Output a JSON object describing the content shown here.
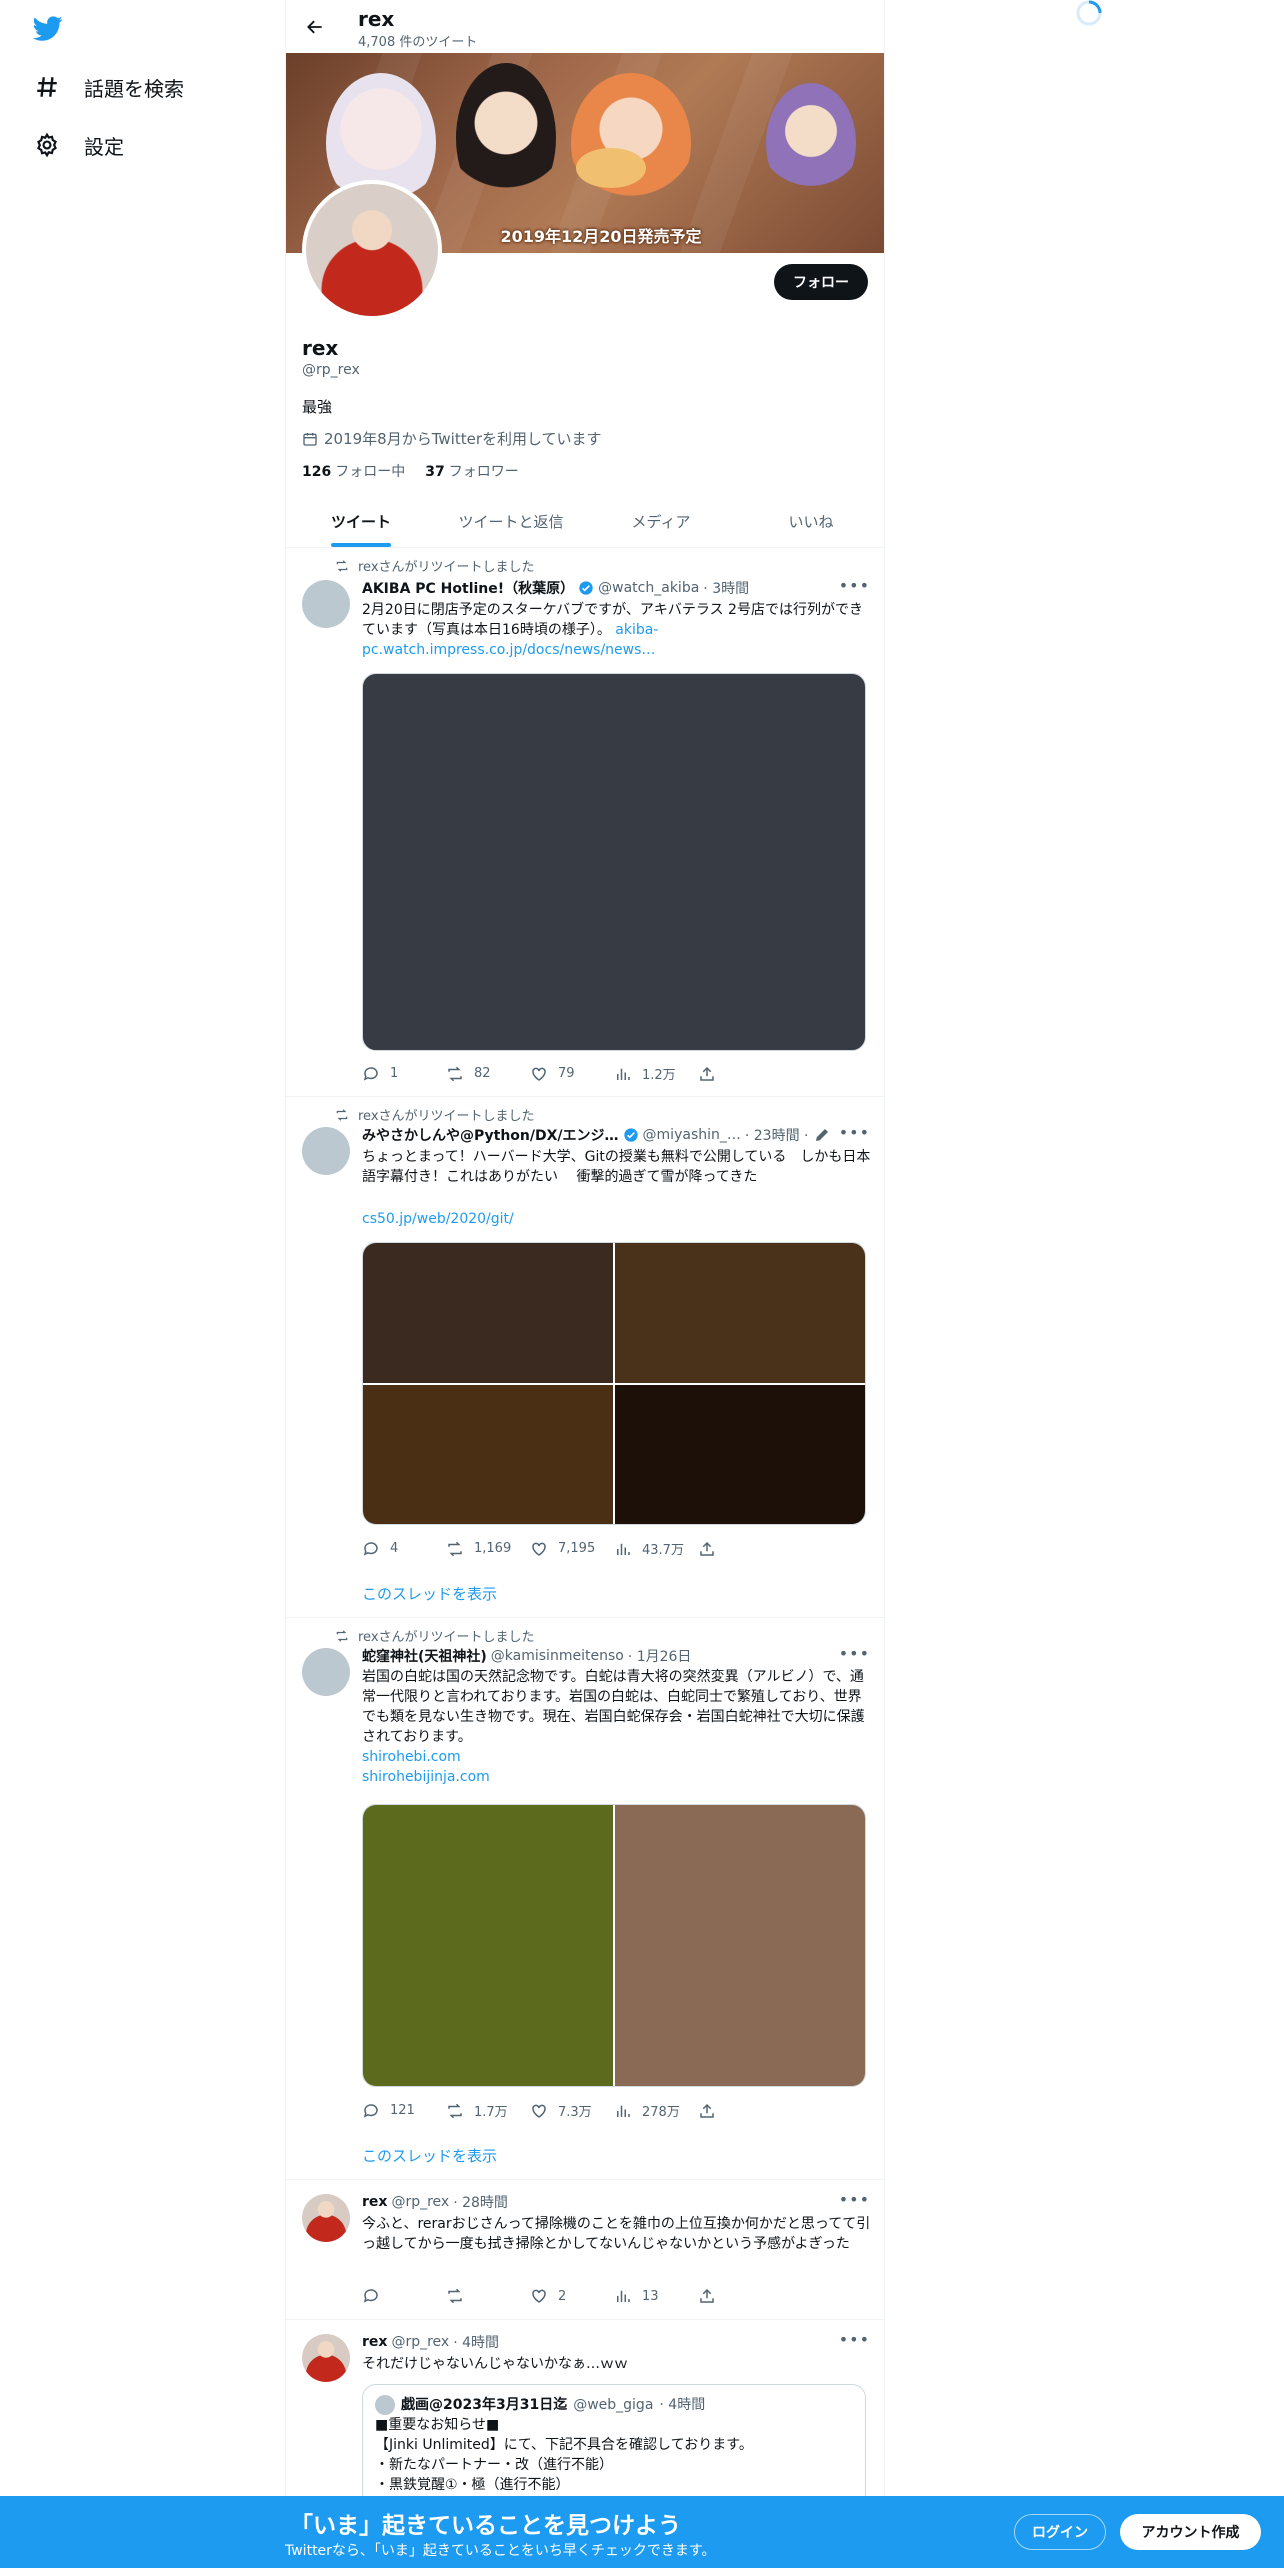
{
  "sidebar": {
    "logo": "twitter-bird-icon",
    "items": [
      {
        "icon": "hashtag-icon",
        "label": "話題を検索"
      },
      {
        "icon": "gear-icon",
        "label": "設定"
      }
    ]
  },
  "header": {
    "name": "rex",
    "tweet_count": "4,708 件のツイート"
  },
  "banner": {
    "caption": "2019年12月20日発売予定"
  },
  "profile": {
    "follow_button": "フォロー",
    "name": "rex",
    "handle": "@rp_rex",
    "bio": "最強",
    "joined": "2019年8月からTwitterを利用しています",
    "following_count": "126",
    "following_label": "フォロー中",
    "followers_count": "37",
    "followers_label": "フォロワー"
  },
  "tabs": [
    {
      "label": "ツイート",
      "active": true
    },
    {
      "label": "ツイートと返信",
      "active": false
    },
    {
      "label": "メディア",
      "active": false
    },
    {
      "label": "いいね",
      "active": false
    }
  ],
  "tweets": [
    {
      "retweeted_by": "rexさんがリツイートしました",
      "name": "AKIBA PC Hotline!（秋葉原）",
      "verified": true,
      "handle": "@watch_akiba",
      "time": "· 3時間",
      "text": "2月20日に閉店予定のスターケバブですが、アキバテラス 2号店では行列ができています（写真は本日16時頃の様子）。",
      "link": "akiba-pc.watch.impress.co.jp/docs/news/news…",
      "replies": "1",
      "retweets": "82",
      "likes": "79",
      "views": "1.2万",
      "media_color": "#363b44"
    },
    {
      "retweeted_by": "rexさんがリツイートしました",
      "name": "みやさかしんや@Python/DX/エンジ…",
      "verified": true,
      "handle": "@miyashin_…",
      "time": "· 23時間 ·",
      "text": "ちょっとまって！ハーバード大学、Gitの授業も無料で公開している　しかも日本語字幕付き！これはありがたい　 衝撃的過ぎて雪が降ってきた",
      "link": "cs50.jp/web/2020/git/",
      "replies": "4",
      "retweets": "1,169",
      "likes": "7,195",
      "views": "43.7万",
      "media_colors": [
        "#3a2a1f",
        "#4a3119",
        "#4b2f14",
        "#1c1009"
      ],
      "thread_link": "このスレッドを表示"
    },
    {
      "retweeted_by": "rexさんがリツイートしました",
      "name": "蛇窪神社(天祖神社)",
      "verified": false,
      "handle": "@kamisinmeitenso",
      "time": "· 1月26日",
      "text": "岩国の白蛇は国の天然記念物です。白蛇は青大将の突然変異（アルビノ）で、通常一代限りと言われております。岩国の白蛇は、白蛇同士で繁殖しており、世界でも類を見ない生き物です。現在、岩国白蛇保存会・岩国白蛇神社で大切に保護されております。",
      "links": [
        "shirohebi.com",
        "shirohebijinja.com"
      ],
      "replies": "121",
      "retweets": "1.7万",
      "likes": "7.3万",
      "views": "278万",
      "media_colors": [
        "#5b6a1c",
        "#8b6a55"
      ],
      "thread_link": "このスレッドを表示"
    },
    {
      "name": "rex",
      "handle": "@rp_rex",
      "time": "· 28時間",
      "text": "今ふと、rerarおじさんって掃除機のことを雑巾の上位互換か何かだと思ってて引っ越してから一度も拭き掃除とかしてないんじゃないかという予感がよぎった",
      "replies": "",
      "retweets": "",
      "likes": "2",
      "views": "13"
    },
    {
      "name": "rex",
      "handle": "@rp_rex",
      "time": "· 4時間",
      "text": "それだけじゃないんじゃないかなぁ…ｗｗ",
      "quote": {
        "name": "戯画@2023年3月31日迄",
        "handle": "@web_giga",
        "time": "· 4時間",
        "lines": [
          "■重要なお知らせ■",
          "【Jinki Unlimited】にて、下記不具合を確認しております。",
          "・新たなパートナー・改（進行不能）",
          "・黒鉄覚醒①・極（進行不能）"
        ]
      }
    }
  ],
  "bottom_bar": {
    "title": "「いま」起きていることを見つけよう",
    "subtitle": "Twitterなら、「いま」起きていることをいち早くチェックできます。",
    "login": "ログイン",
    "signup": "アカウント作成"
  }
}
